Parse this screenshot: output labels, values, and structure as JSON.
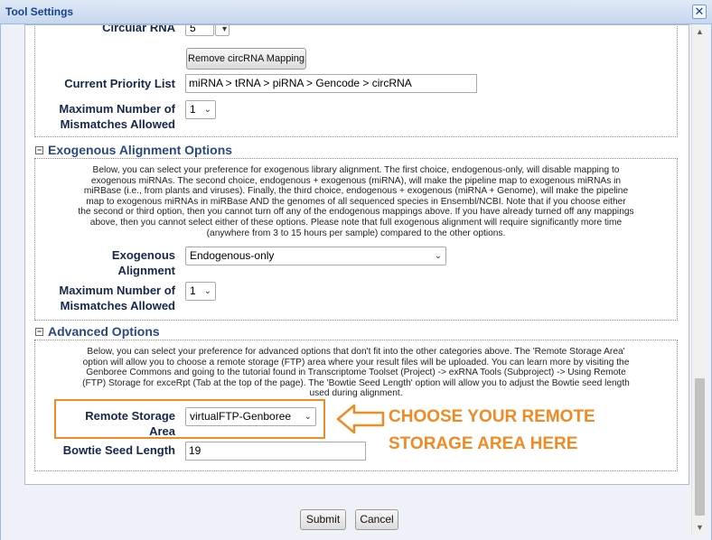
{
  "window": {
    "title": "Tool Settings",
    "close_label": "✕"
  },
  "circular": {
    "label": "Circular RNA",
    "value": "5",
    "remove_button": "Remove circRNA Mapping"
  },
  "priority": {
    "label": "Current Priority List",
    "value": "miRNA > tRNA > piRNA > Gencode > circRNA"
  },
  "mismatch1": {
    "label_line1": "Maximum Number of",
    "label_line2": "Mismatches Allowed",
    "value": "1"
  },
  "exogenous": {
    "section_title": "Exogenous Alignment Options",
    "description": [
      "Below, you can select your preference for exogenous library alignment. The first choice, endogenous-only, will disable mapping to",
      "exogenous miRNAs. The second choice, endogenous + exogenous (miRNA), will make the pipeline map to exogenous miRNAs in",
      "miRBase (i.e., from plants and viruses). Finally, the third choice, endogenous + exogenous (miRNA + Genome), will make the pipeline",
      "map to exogenous miRNAs in miRBase AND the genomes of all sequenced species in Ensembl/NCBI. Note that if you choose either",
      "the second or third option, then you cannot turn off any of the endogenous mappings above. If you have already turned off any mappings",
      "above, then you cannot select either of these options. Please note that full exogenous alignment will require significantly more time",
      "(anywhere from 3 to 15 hours per sample) compared to the other options."
    ],
    "alignment_label_line1": "Exogenous",
    "alignment_label_line2": "Alignment",
    "alignment_value": "Endogenous-only",
    "mismatch_label_line1": "Maximum Number of",
    "mismatch_label_line2": "Mismatches Allowed",
    "mismatch_value": "1"
  },
  "advanced": {
    "section_title": "Advanced Options",
    "description": [
      "Below, you can select your preference for advanced options that don't fit into the other categories above. The 'Remote Storage Area'",
      "option will allow you to choose a remote storage (FTP) area where your result files will be uploaded. You can learn more by visiting the",
      "Genboree Commons and going to the tutorial found in Transcriptome Toolset (Project) -> exRNA Tools (Subproject) -> Using Remote",
      "(FTP) Storage for exceRpt (Tab at the top of the page). The 'Bowtie Seed Length' option will allow you to adjust the Bowtie seed length",
      "used during alignment."
    ],
    "storage_label_line1": "Remote Storage",
    "storage_label_line2": "Area",
    "storage_value": "virtualFTP-Genboree",
    "seed_label": "Bowtie Seed Length",
    "seed_value": "19"
  },
  "annotation": {
    "line1": "CHOOSE YOUR REMOTE",
    "line2": "STORAGE AREA HERE",
    "color": "#f08a24"
  },
  "footer": {
    "submit": "Submit",
    "cancel": "Cancel"
  },
  "icons": {
    "collapse": "minus-box-icon",
    "close": "close-icon",
    "arrow": "left-arrow-icon"
  }
}
